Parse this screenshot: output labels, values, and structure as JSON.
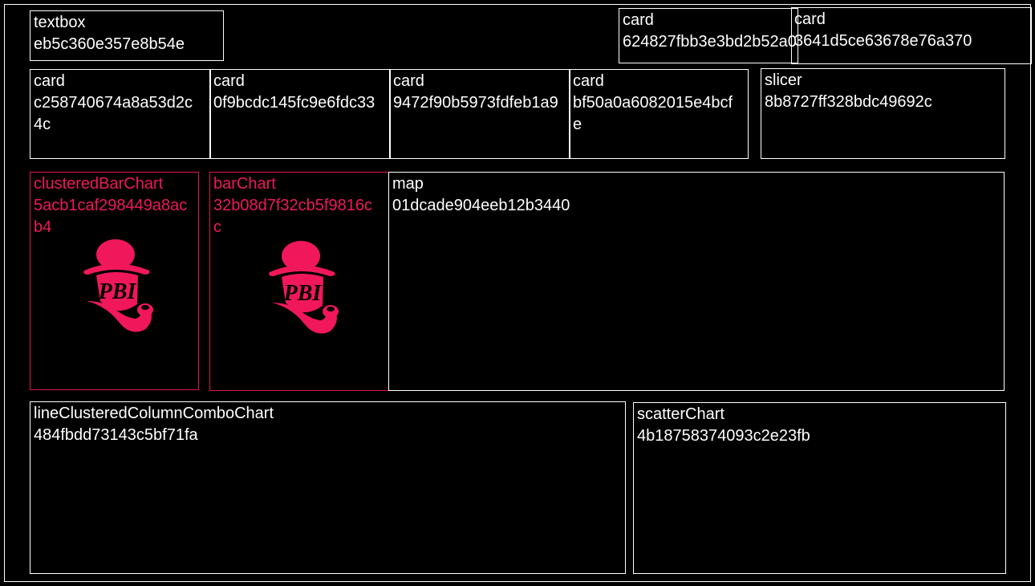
{
  "visuals": {
    "textbox": {
      "type": "textbox",
      "id": "eb5c360e357e8b54e"
    },
    "card_top1": {
      "type": "card",
      "id": "624827fbb3e3bd2b52a0"
    },
    "card_top2": {
      "type": "card",
      "id": "3641d5ce63678e76a370"
    },
    "card1": {
      "type": "card",
      "id": "c258740674a8a53d2c4c"
    },
    "card2": {
      "type": "card",
      "id": "0f9bcdc145fc9e6fdc33"
    },
    "card3": {
      "type": "card",
      "id": "9472f90b5973fdfeb1a9"
    },
    "card4": {
      "type": "card",
      "id": "bf50a0a6082015e4bcfe"
    },
    "slicer": {
      "type": "slicer",
      "id": "8b8727ff328bdc49692c"
    },
    "clustered_bar": {
      "type": "clusteredBarChart",
      "id": "5acb1caf298449a8acb4"
    },
    "bar": {
      "type": "barChart",
      "id": "32b08d7f32cb5f9816cc"
    },
    "map": {
      "type": "map",
      "id": "01dcade904eeb12b3440"
    },
    "combo": {
      "type": "lineClusteredColumnComboChart",
      "id": "484fbdd73143c5bf71fa"
    },
    "scatter": {
      "type": "scatterChart",
      "id": "4b18758374093c2e23fb"
    }
  },
  "placeholder_logo_text": "PBI",
  "colors": {
    "accent": "#e0144c",
    "border": "#ffffff",
    "background": "#000000"
  }
}
